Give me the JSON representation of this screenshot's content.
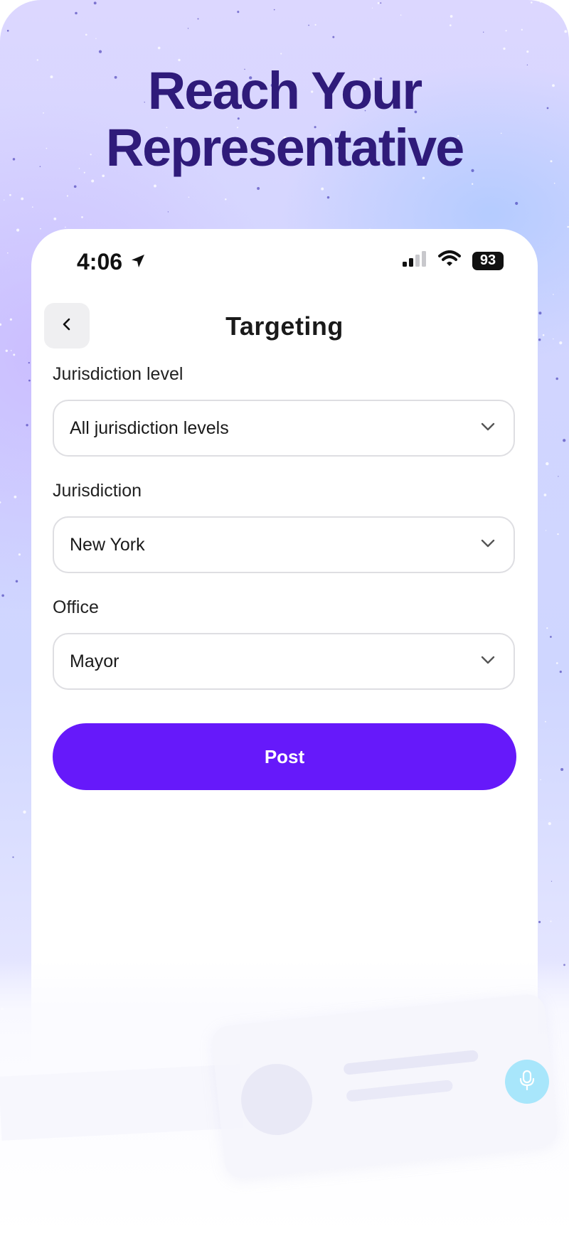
{
  "headline": {
    "line1": "Reach Your",
    "line2": "Representative"
  },
  "status_bar": {
    "time": "4:06",
    "battery": "93"
  },
  "screen": {
    "title": "Targeting"
  },
  "form": {
    "jurisdiction_level": {
      "label": "Jurisdiction level",
      "value": "All jurisdiction levels"
    },
    "jurisdiction": {
      "label": "Jurisdiction",
      "value": "New York"
    },
    "office": {
      "label": "Office",
      "value": "Mayor"
    },
    "post_label": "Post"
  },
  "colors": {
    "headline": "#2f1b7a",
    "accent": "#6619fa",
    "mic_button": "#a8e6fb"
  },
  "icons": {
    "back": "chevron-left-icon",
    "dropdown": "chevron-down-icon",
    "location": "location-arrow-icon",
    "signal": "cellular-signal-icon",
    "wifi": "wifi-icon",
    "mic": "microphone-icon"
  }
}
